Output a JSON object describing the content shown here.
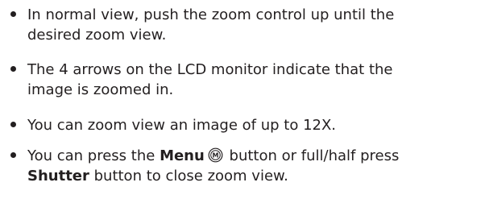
{
  "bullets": [
    {
      "line1": "In normal view, push the zoom control up until the",
      "line2": "desired zoom view."
    },
    {
      "line1": "The 4 arrows on the LCD monitor indicate that the",
      "line2": "image is zoomed in."
    },
    {
      "line1": "You can zoom view an image of up to 12X."
    },
    {
      "line1_before": "You can press the ",
      "menu_word": "Menu",
      "line1_after": " button or full/half press",
      "shutter_word": "Shutter",
      "line2_after": " button to close zoom view.",
      "menu_icon_letter": "M"
    }
  ],
  "colors": {
    "text": "#231f20",
    "background": "#ffffff"
  },
  "icons": {
    "bullet": "filled-circle",
    "menu": "menu-button-icon"
  }
}
